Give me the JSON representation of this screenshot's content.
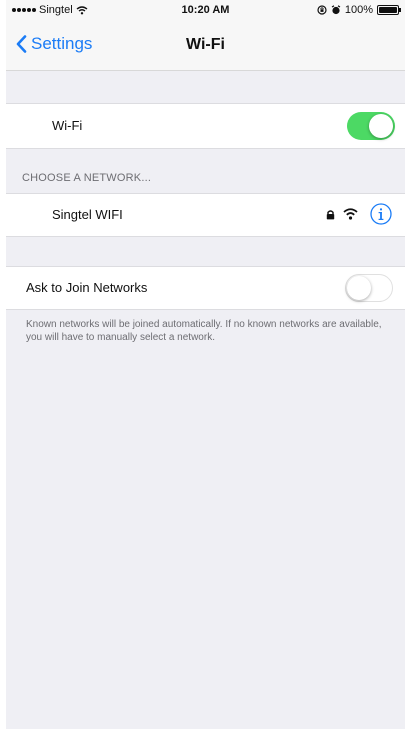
{
  "status_bar": {
    "carrier": "Singtel",
    "time": "10:20 AM",
    "battery": "100%"
  },
  "nav": {
    "back_label": "Settings",
    "title": "Wi-Fi"
  },
  "wifi_row": {
    "label": "Wi-Fi",
    "enabled": true
  },
  "networks_section": {
    "header": "CHOOSE A NETWORK...",
    "networks": [
      {
        "name": "Singtel WIFI",
        "secured": true
      }
    ]
  },
  "ask_to_join": {
    "label": "Ask to Join Networks",
    "enabled": false,
    "footer": "Known networks will be joined automatically. If no known networks are available, you will have to manually select a network."
  },
  "colors": {
    "accent": "#1b7cf6",
    "toggle_on": "#4cd964",
    "background": "#efeff4"
  }
}
